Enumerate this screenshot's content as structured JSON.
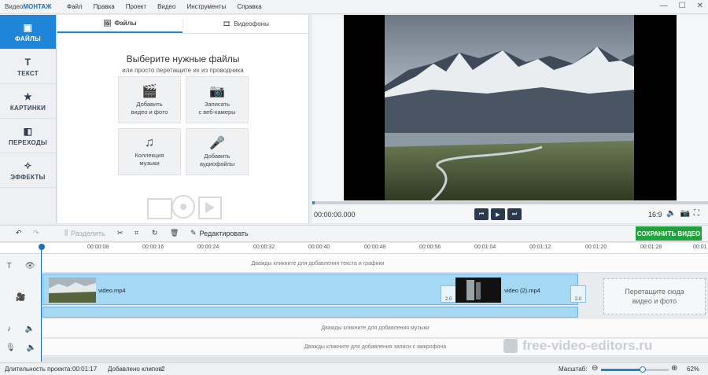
{
  "app": {
    "title_prefix": "Видео",
    "title_brand": "МОНТАЖ"
  },
  "menu": [
    "Файл",
    "Правка",
    "Проект",
    "Видео",
    "Инструменты",
    "Справка"
  ],
  "window_controls": {
    "minimize": "—",
    "maximize": "☐",
    "close": "✕"
  },
  "nav": [
    {
      "label": "ФАЙЛЫ",
      "icon": "files-icon",
      "active": true
    },
    {
      "label": "ТЕКСТ",
      "icon": "text-icon"
    },
    {
      "label": "КАРТИНКИ",
      "icon": "star-icon"
    },
    {
      "label": "ПЕРЕХОДЫ",
      "icon": "transitions-icon"
    },
    {
      "label": "ЭФФЕКТЫ",
      "icon": "effects-wand-icon"
    }
  ],
  "files": {
    "tabs": [
      {
        "label": "Файлы",
        "active": true
      },
      {
        "label": "Видеофоны"
      }
    ],
    "heading": "Выберите нужные файлы",
    "subheading": "или просто перетащите их из проводника",
    "tiles": [
      {
        "label": "Добавить\nвидео и фото",
        "icon": "film-camera-icon"
      },
      {
        "label": "Записать\nс веб-камеры",
        "icon": "webcam-icon"
      },
      {
        "label": "Коллекция\nмузыки",
        "icon": "music-notes-icon"
      },
      {
        "label": "Добавить\nаудиофайлы",
        "icon": "microphone-icon"
      }
    ]
  },
  "preview": {
    "timecode": "00:00:00.000",
    "aspect": "16:9",
    "progress": 0.0
  },
  "toolbar": {
    "split_label": "Разделить",
    "edit_label": "Редактировать",
    "save_label": "СОХРАНИТЬ ВИДЕО"
  },
  "ruler": [
    "00:00:08",
    "00:00:16",
    "00:00:24",
    "00:00:32",
    "00:00:40",
    "00:00:48",
    "00:00:56",
    "00:01:04",
    "00:01:12",
    "00:01:20",
    "00:01:28",
    "00:01"
  ],
  "tracks": {
    "text_hint": "Дважды кликните для добавления текста и графики",
    "music_hint": "Дважды кликните для добавления музыки",
    "mic_hint": "Дважды кликните для добавления записи с микрофона",
    "clips": [
      {
        "name": "video.mp4"
      },
      {
        "name": "video (2).mp4"
      }
    ],
    "transition_duration": "2.0",
    "drop_zone": "Перетащите сюда\nвидео и фото"
  },
  "watermark": "free-video-editors.ru",
  "status": {
    "duration_label": "Длительность проекта:",
    "duration_value": "00:01:17",
    "clips_label": "Добавлено клипов:",
    "clips_value": "2",
    "zoom_label": "Масштаб:",
    "zoom_value": "62%",
    "zoom_level": 0.62
  }
}
